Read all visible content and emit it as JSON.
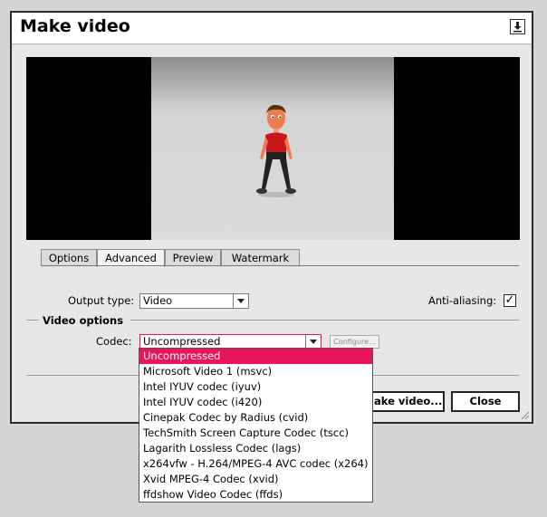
{
  "window": {
    "title": "Make video"
  },
  "tabs": [
    {
      "label": "Options",
      "active": false
    },
    {
      "label": "Advanced",
      "active": true
    },
    {
      "label": "Preview",
      "active": false
    },
    {
      "label": "Watermark",
      "active": false
    }
  ],
  "output": {
    "label": "Output type:",
    "value": "Video"
  },
  "antialias": {
    "label": "Anti-aliasing:",
    "checked": true
  },
  "video_options": {
    "heading": "Video options"
  },
  "codec": {
    "label": "Codec:",
    "value": "Uncompressed",
    "configure_label": "Configure...",
    "options": [
      "Uncompressed",
      "Microsoft Video 1 (msvc)",
      "Intel IYUV codec (iyuv)",
      "Intel IYUV codec (i420)",
      "Cinepak Codec by Radius (cvid)",
      "TechSmith Screen Capture Codec (tscc)",
      "Lagarith Lossless Codec (lags)",
      "x264vfw - H.264/MPEG-4 AVC codec (x264)",
      "Xvid MPEG-4 Codec (xvid)",
      "ffdshow Video Codec (ffds)"
    ],
    "selected_index": 0
  },
  "buttons": {
    "make_video": "Make video...",
    "close": "Close"
  },
  "colors": {
    "highlight": "#e8155a"
  },
  "icons": {
    "pin": "pin-icon",
    "character": "cartoon-character",
    "grip": "resize-grip-icon"
  }
}
